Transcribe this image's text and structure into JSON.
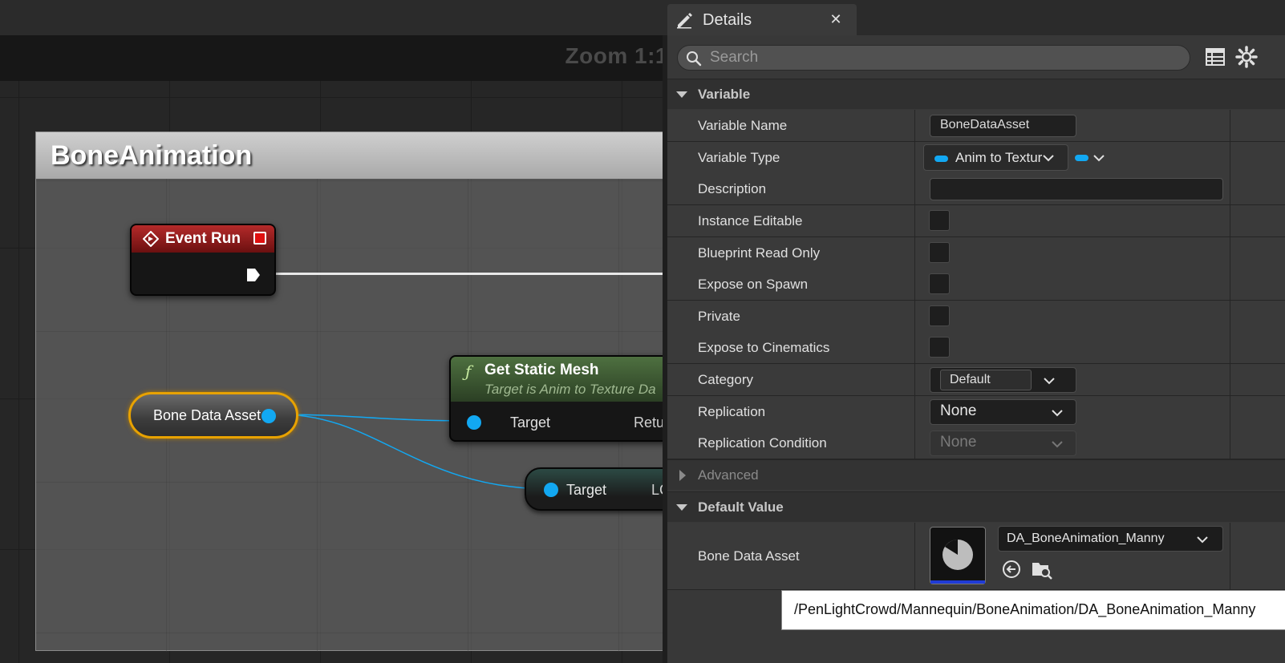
{
  "graph": {
    "zoom_label": "Zoom 1:1",
    "comment_title": "BoneAnimation",
    "event_node": {
      "title": "Event Run"
    },
    "variable_node": {
      "label": "Bone Data Asset"
    },
    "get_mesh_node": {
      "icon_glyph": "ƒ",
      "title": "Get Static Mesh",
      "subtitle": "Target is Anim to Texture Da",
      "target_label": "Target",
      "return_label": "Retu"
    },
    "target_node": {
      "label": "Target",
      "right_label": "LC"
    },
    "colors": {
      "object_pin": "#12a8f2",
      "selection": "#e8a200",
      "event_header": "#9a1d1d",
      "function_header": "#4a6b3c"
    }
  },
  "details": {
    "tab_title": "Details",
    "close_glyph": "✕",
    "search": {
      "placeholder": "Search",
      "value": ""
    },
    "sections": {
      "variable": "Variable",
      "advanced": "Advanced",
      "default_value": "Default Value"
    },
    "properties": {
      "variable_name": {
        "label": "Variable Name",
        "value": "BoneDataAsset"
      },
      "variable_type": {
        "label": "Variable Type",
        "value": "Anim to Textur"
      },
      "description": {
        "label": "Description",
        "value": ""
      },
      "instance_editable": {
        "label": "Instance Editable",
        "checked": false
      },
      "blueprint_read_only": {
        "label": "Blueprint Read Only",
        "checked": false
      },
      "expose_on_spawn": {
        "label": "Expose on Spawn",
        "checked": false
      },
      "private": {
        "label": "Private",
        "checked": false
      },
      "expose_to_cinematics": {
        "label": "Expose to Cinematics",
        "checked": false
      },
      "category": {
        "label": "Category",
        "value": "Default"
      },
      "replication": {
        "label": "Replication",
        "value": "None"
      },
      "replication_condition": {
        "label": "Replication Condition",
        "value": "None"
      },
      "bone_data_asset": {
        "label": "Bone Data Asset",
        "value": "DA_BoneAnimation_Manny"
      }
    },
    "tooltip": "/PenLightCrowd/Mannequin/BoneAnimation/DA_BoneAnimation_Manny"
  }
}
